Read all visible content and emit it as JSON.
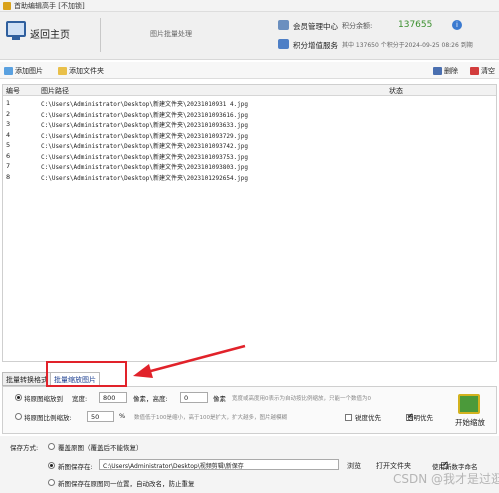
{
  "window": {
    "title": "首助编辑高手 [不加锁]"
  },
  "header": {
    "home_label": "返回主页",
    "page_subtitle": "图片批量处理",
    "member_center": "会员管理中心",
    "balance_label": "积分余额:",
    "balance_value": "137655",
    "vip_service": "积分增值服务",
    "vip_note": "其中 137650 个积分于2024-09-25 08:26 到期"
  },
  "toolbar": {
    "add_image": "添加图片",
    "add_folder": "添加文件夹",
    "delete": "删除",
    "clear": "清空"
  },
  "table": {
    "headers": [
      "编号",
      "图片路径",
      "状态"
    ],
    "rows": [
      {
        "no": "1",
        "path": "C:\\Users\\Administrator\\Desktop\\新建文件夹\\20231010931 4.jpg"
      },
      {
        "no": "2",
        "path": "C:\\Users\\Administrator\\Desktop\\新建文件夹\\2023101093616.jpg"
      },
      {
        "no": "3",
        "path": "C:\\Users\\Administrator\\Desktop\\新建文件夹\\2023101093633.jpg"
      },
      {
        "no": "4",
        "path": "C:\\Users\\Administrator\\Desktop\\新建文件夹\\2023101093729.jpg"
      },
      {
        "no": "5",
        "path": "C:\\Users\\Administrator\\Desktop\\新建文件夹\\2023101093742.jpg"
      },
      {
        "no": "6",
        "path": "C:\\Users\\Administrator\\Desktop\\新建文件夹\\2023101093753.jpg"
      },
      {
        "no": "7",
        "path": "C:\\Users\\Administrator\\Desktop\\新建文件夹\\2023101093803.jpg"
      },
      {
        "no": "8",
        "path": "C:\\Users\\Administrator\\Desktop\\新建文件夹\\2023101292654.jpg"
      }
    ]
  },
  "tabs": {
    "format": "批量转换格式",
    "resize": "批量缩放图片"
  },
  "resize": {
    "option_fixed": "将原图缩放到",
    "width_label": "宽度:",
    "width_value": "800",
    "px1": "像素，高度:",
    "height_value": "0",
    "px2": "像素",
    "fixed_note": "宽度或高度用0表示为自动按比例缩放，只能一个数值为0",
    "option_ratio": "将原图比例缩放:",
    "ratio_value": "50",
    "percent": "%",
    "ratio_note": "数值低于100是缩小，高于100是扩大，扩大越多，图片越模糊",
    "sharpen": "锐度优先",
    "transparent": "透明优先",
    "start": "开始缩放"
  },
  "save": {
    "label": "保存方式:",
    "overwrite": "覆盖原图（覆盖后不能恢复）",
    "new_path_label": "新图保存在:",
    "new_path_value": "C:\\Users\\Administrator\\Desktop\\视频剪辑\\新保存",
    "browse": "浏览",
    "open_folder": "打开文件夹",
    "use_new_name": "使用新数字命名",
    "same_location": "新图保存在原图同一位置，自动改名，防止重复"
  },
  "watermark": "CSDN @我才是过逛"
}
